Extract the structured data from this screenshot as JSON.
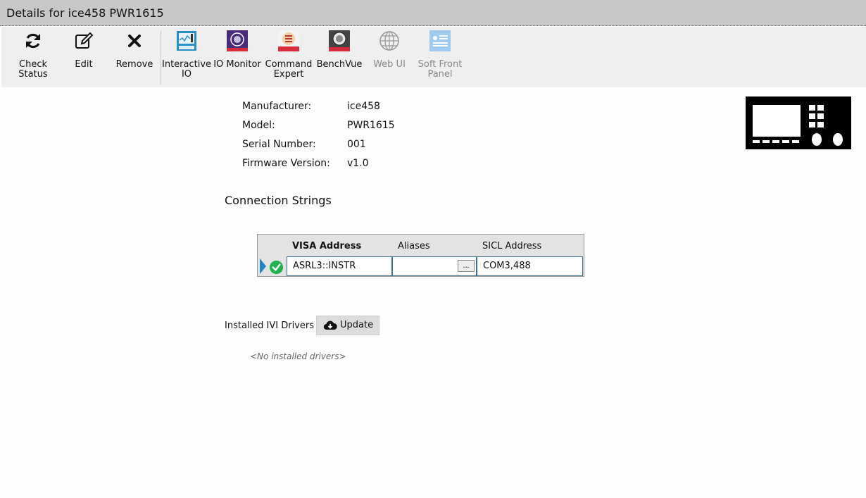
{
  "window": {
    "title": "Details for ice458 PWR1615"
  },
  "toolbar": {
    "buttons": [
      {
        "label": "Check\nStatus",
        "icon": "refresh-icon"
      },
      {
        "label": "Edit",
        "icon": "edit-icon"
      },
      {
        "label": "Remove",
        "icon": "close-icon"
      },
      {
        "label": "Interactive\nIO",
        "icon": "interactive-io-icon"
      },
      {
        "label": "IO Monitor",
        "icon": "io-monitor-icon"
      },
      {
        "label": "Command\nExpert",
        "icon": "command-expert-icon"
      },
      {
        "label": "BenchVue",
        "icon": "benchvue-icon"
      },
      {
        "label": "Web UI",
        "icon": "globe-icon",
        "disabled": true
      },
      {
        "label": "Soft Front\nPanel",
        "icon": "soft-front-panel-icon",
        "disabled": true
      }
    ]
  },
  "info": {
    "manufacturer_label": "Manufacturer:",
    "manufacturer": "ice458",
    "model_label": "Model:",
    "model": "PWR1615",
    "serial_label": "Serial Number:",
    "serial": "001",
    "firmware_label": "Firmware Version:",
    "firmware": "v1.0"
  },
  "connections": {
    "title": "Connection Strings",
    "headers": {
      "visa": "VISA Address",
      "aliases": "Aliases",
      "sicl": "SICL Address"
    },
    "rows": [
      {
        "visa": "ASRL3::INSTR",
        "aliases": "",
        "alias_button": "...",
        "sicl": "COM3,488",
        "status": "ok"
      }
    ]
  },
  "drivers": {
    "label": "Installed IVI Drivers",
    "update_label": "Update",
    "empty_text": "<No installed drivers>"
  },
  "colors": {
    "titlebar": "#c8c8c8",
    "toolbar": "#efefef",
    "status_ok": "#20b14c",
    "row_indicator": "#1e88c7"
  }
}
